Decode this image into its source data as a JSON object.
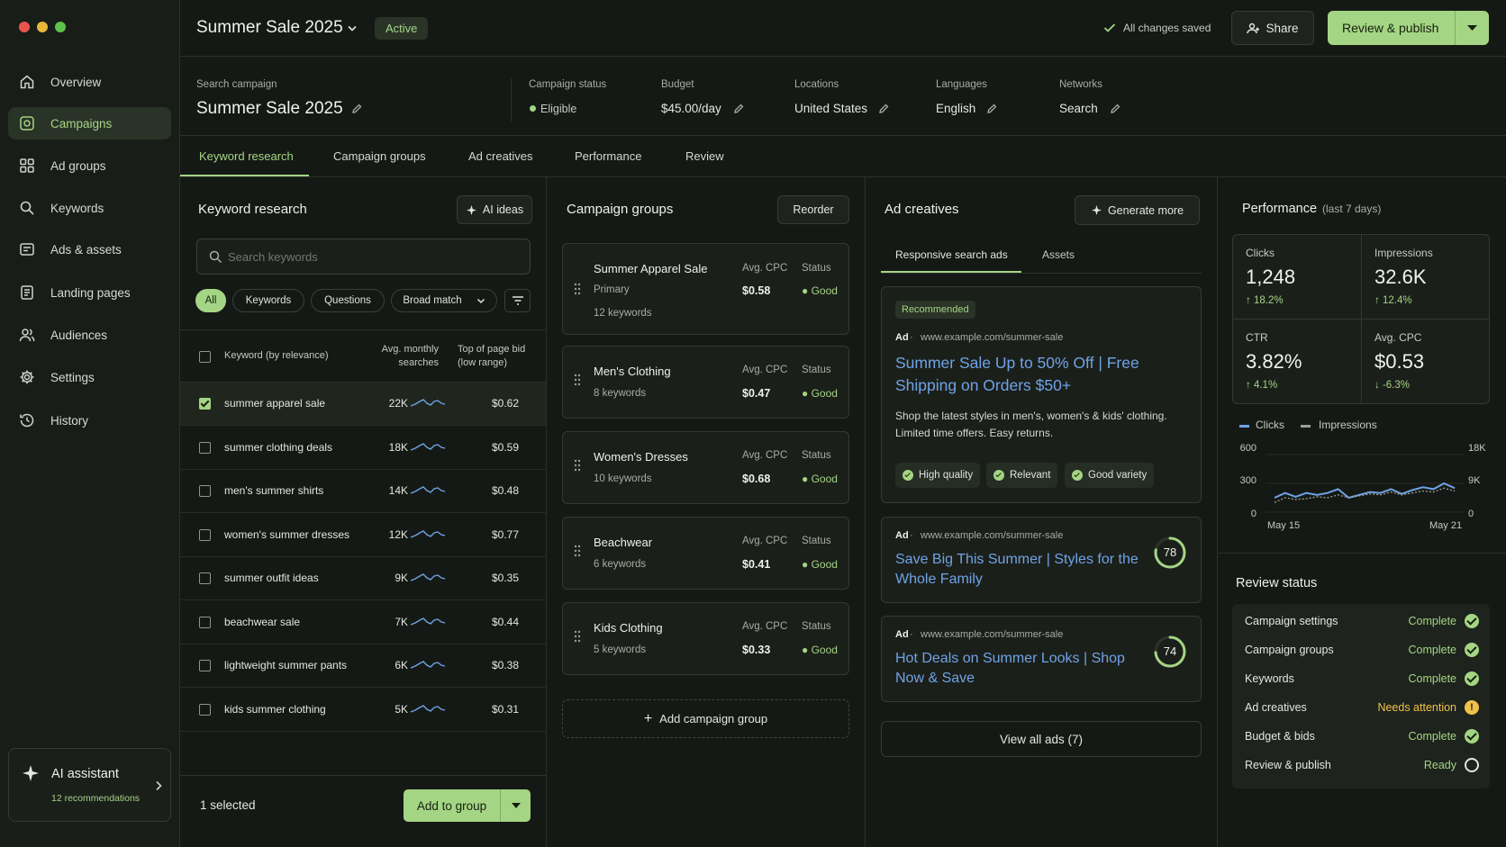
{
  "app": {
    "colors": {
      "accent": "#a4d584",
      "link": "#6fa3e6",
      "warning": "#f0c24b",
      "background": "#151915"
    }
  },
  "sidebar": {
    "items": [
      {
        "label": "Overview",
        "icon": "home-icon"
      },
      {
        "label": "Campaigns",
        "icon": "campaign-icon",
        "active": true
      },
      {
        "label": "Ad groups",
        "icon": "grid-icon"
      },
      {
        "label": "Keywords",
        "icon": "search-icon"
      },
      {
        "label": "Ads & assets",
        "icon": "ad-icon"
      },
      {
        "label": "Landing pages",
        "icon": "page-icon"
      },
      {
        "label": "Audiences",
        "icon": "users-icon"
      },
      {
        "label": "Settings",
        "icon": "gear-icon"
      },
      {
        "label": "History",
        "icon": "history-icon"
      }
    ],
    "assistant": {
      "title": "AI assistant",
      "subtitle": "12 recommendations"
    }
  },
  "header": {
    "title": "Summer Sale 2025",
    "status_badge": "Active",
    "saved": "All changes saved",
    "share": "Share",
    "publish": "Review & publish"
  },
  "summary": {
    "type_label": "Search campaign",
    "name": "Summer Sale 2025",
    "fields": [
      {
        "label": "Campaign status",
        "value": "Eligible"
      },
      {
        "label": "Budget",
        "value": "$45.00/day"
      },
      {
        "label": "Locations",
        "value": "United States"
      },
      {
        "label": "Languages",
        "value": "English"
      },
      {
        "label": "Networks",
        "value": "Search"
      }
    ]
  },
  "tabs": [
    "Keyword research",
    "Campaign groups",
    "Ad creatives",
    "Performance",
    "Review"
  ],
  "keyword_research": {
    "title": "Keyword research",
    "ai_ideas": "AI ideas",
    "search_placeholder": "Search keywords",
    "filters": [
      "All",
      "Keywords",
      "Questions",
      "Broad match"
    ],
    "columns": {
      "keyword": "Keyword (by relevance)",
      "searches": "Avg. monthly searches",
      "bid": "Top of page bid (low range)"
    },
    "rows": [
      {
        "keyword": "summer apparel sale",
        "searches": "22K",
        "bid": "$0.62",
        "selected": true
      },
      {
        "keyword": "summer clothing deals",
        "searches": "18K",
        "bid": "$0.59",
        "selected": false
      },
      {
        "keyword": "men's summer shirts",
        "searches": "14K",
        "bid": "$0.48",
        "selected": false
      },
      {
        "keyword": "women's summer dresses",
        "searches": "12K",
        "bid": "$0.77",
        "selected": false
      },
      {
        "keyword": "summer outfit ideas",
        "searches": "9K",
        "bid": "$0.35",
        "selected": false
      },
      {
        "keyword": "beachwear sale",
        "searches": "7K",
        "bid": "$0.44",
        "selected": false
      },
      {
        "keyword": "lightweight summer pants",
        "searches": "6K",
        "bid": "$0.38",
        "selected": false
      },
      {
        "keyword": "kids summer clothing",
        "searches": "5K",
        "bid": "$0.31",
        "selected": false
      }
    ],
    "selected_count": "1 selected",
    "add_to_group": "Add to group"
  },
  "campaign_groups": {
    "title": "Campaign groups",
    "reorder": "Reorder",
    "cpc_label": "Avg. CPC",
    "status_label": "Status",
    "groups": [
      {
        "name": "Summer Apparel Sale",
        "tag": "Primary",
        "keywords": "12 keywords",
        "cpc": "$0.58",
        "status": "Good"
      },
      {
        "name": "Men's Clothing",
        "keywords": "8 keywords",
        "cpc": "$0.47",
        "status": "Good"
      },
      {
        "name": "Women's Dresses",
        "keywords": "10 keywords",
        "cpc": "$0.68",
        "status": "Good"
      },
      {
        "name": "Beachwear",
        "keywords": "6 keywords",
        "cpc": "$0.41",
        "status": "Good"
      },
      {
        "name": "Kids Clothing",
        "keywords": "5 keywords",
        "cpc": "$0.33",
        "status": "Good"
      }
    ],
    "add": "Add campaign group"
  },
  "ad_creatives": {
    "title": "Ad creatives",
    "generate": "Generate more",
    "subtabs": [
      "Responsive search ads",
      "Assets"
    ],
    "ad_label": "Ad",
    "url": "www.example.com/summer-sale",
    "featured": {
      "badge": "Recommended",
      "headline": "Summer Sale Up to 50% Off | Free Shipping on Orders $50+",
      "description": "Shop the latest styles in men's, women's & kids' clothing. Limited time offers. Easy returns.",
      "tags": [
        "High quality",
        "Relevant",
        "Good variety"
      ]
    },
    "ads": [
      {
        "headline": "Save Big This Summer | Styles for the Whole Family",
        "score": "78",
        "score_value": 78
      },
      {
        "headline": "Hot Deals on Summer Looks | Shop Now & Save",
        "score": "74",
        "score_value": 74
      }
    ],
    "view_all": "View all ads (7)"
  },
  "performance": {
    "title": "Performance",
    "period": "(last 7 days)",
    "metrics": [
      {
        "label": "Clicks",
        "value": "1,248",
        "change": "18.2%",
        "direction": "up"
      },
      {
        "label": "Impressions",
        "value": "32.6K",
        "change": "12.4%",
        "direction": "up"
      },
      {
        "label": "CTR",
        "value": "3.82%",
        "change": "4.1%",
        "direction": "up"
      },
      {
        "label": "Avg. CPC",
        "value": "$0.53",
        "change": "-6.3%",
        "direction": "down"
      }
    ]
  },
  "chart_data": {
    "type": "line",
    "series": [
      {
        "name": "Clicks",
        "color": "#6fa3e6",
        "axis": "left",
        "values": [
          150,
          200,
          160,
          200,
          180,
          200,
          240,
          150,
          180,
          210,
          200,
          240,
          190,
          230,
          260,
          240,
          300,
          250
        ]
      },
      {
        "name": "Impressions",
        "color": "#9aa096",
        "axis": "right",
        "values": [
          3000,
          4500,
          4000,
          4200,
          4800,
          4500,
          5400,
          4500,
          5100,
          5700,
          5400,
          6300,
          5400,
          6000,
          6600,
          6300,
          7500,
          6600
        ]
      }
    ],
    "x_labels": [
      "May 15",
      "May 21"
    ],
    "y_left_ticks": [
      "600",
      "300",
      "0"
    ],
    "y_right_ticks": [
      "18K",
      "9K",
      "0"
    ],
    "ylim_left": [
      0,
      600
    ],
    "ylim_right": [
      0,
      18000
    ]
  },
  "review_status": {
    "title": "Review status",
    "items": [
      {
        "label": "Campaign settings",
        "status": "Complete",
        "state": "ok"
      },
      {
        "label": "Campaign groups",
        "status": "Complete",
        "state": "ok"
      },
      {
        "label": "Keywords",
        "status": "Complete",
        "state": "ok"
      },
      {
        "label": "Ad creatives",
        "status": "Needs attention",
        "state": "warn"
      },
      {
        "label": "Budget & bids",
        "status": "Complete",
        "state": "ok"
      },
      {
        "label": "Review & publish",
        "status": "Ready",
        "state": "ready"
      }
    ]
  }
}
